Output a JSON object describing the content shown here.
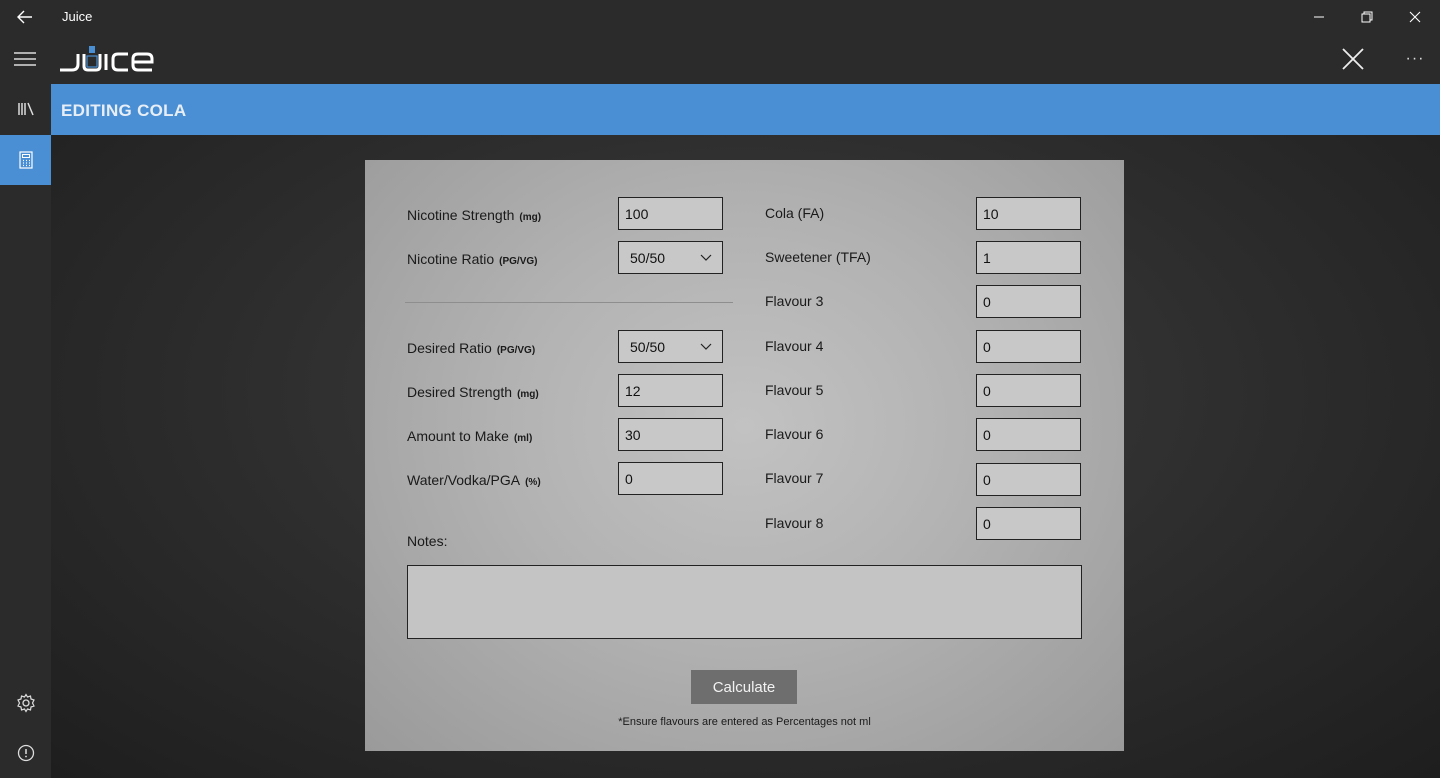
{
  "window": {
    "title": "Juice"
  },
  "header": {
    "logo_text": "JUICE"
  },
  "sidebar": {
    "items": [
      {
        "name": "library",
        "icon": "library-icon"
      },
      {
        "name": "calculator",
        "icon": "calculator-icon",
        "active": true
      },
      {
        "name": "settings",
        "icon": "gear-icon"
      },
      {
        "name": "about",
        "icon": "info-icon"
      }
    ]
  },
  "banner": {
    "title": "EDITING COLA"
  },
  "form": {
    "left": [
      {
        "label": "Nicotine Strength",
        "unit": "(mg)",
        "value": "100",
        "type": "text"
      },
      {
        "label": "Nicotine Ratio",
        "unit": "(PG/VG)",
        "value": "50/50",
        "type": "select"
      },
      {
        "label": "Desired Ratio",
        "unit": "(PG/VG)",
        "value": "50/50",
        "type": "select"
      },
      {
        "label": "Desired Strength",
        "unit": "(mg)",
        "value": "12",
        "type": "text"
      },
      {
        "label": "Amount to Make",
        "unit": "(ml)",
        "value": "30",
        "type": "text"
      },
      {
        "label": "Water/Vodka/PGA",
        "unit": "(%)",
        "value": "0",
        "type": "text"
      }
    ],
    "flavours": [
      {
        "label": "Cola (FA)",
        "value": "10"
      },
      {
        "label": "Sweetener (TFA)",
        "value": "1"
      },
      {
        "label": "Flavour 3",
        "value": "0"
      },
      {
        "label": "Flavour 4",
        "value": "0"
      },
      {
        "label": "Flavour 5",
        "value": "0"
      },
      {
        "label": "Flavour 6",
        "value": "0"
      },
      {
        "label": "Flavour 7",
        "value": "0"
      },
      {
        "label": "Flavour 8",
        "value": "0"
      }
    ],
    "notes_label": "Notes:",
    "notes_value": "",
    "calculate_label": "Calculate",
    "footnote": "*Ensure flavours are entered as Percentages not ml"
  },
  "colors": {
    "accent": "#4a8fd4",
    "chrome": "#2b2b2b",
    "panel": "#b5b5b5",
    "button": "#6e6e6e"
  }
}
